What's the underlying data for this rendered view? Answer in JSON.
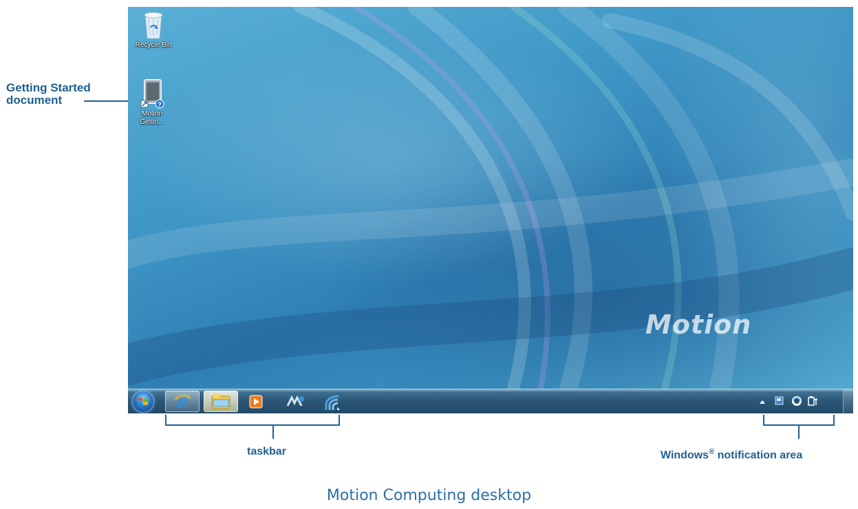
{
  "desktop": {
    "icons": [
      {
        "label": "Recycle Bin",
        "icon": "recycle-bin-icon"
      },
      {
        "label_line1": "Motion",
        "label_line2": "Gettin...",
        "icon": "getting-started-document-icon"
      }
    ],
    "brand": "Motion",
    "background_color": "#3f97c6"
  },
  "taskbar": {
    "items": [
      {
        "icon": "start-orb-icon"
      },
      {
        "icon": "internet-explorer-icon"
      },
      {
        "icon": "windows-explorer-icon"
      },
      {
        "icon": "media-player-icon"
      },
      {
        "icon": "motion-dashboard-icon"
      },
      {
        "icon": "wireless-icon"
      }
    ],
    "tray_icons": [
      "show-hidden-icons-arrow",
      "action-center-icon",
      "network-icon",
      "power-icon"
    ]
  },
  "callouts": {
    "getting_started_line1": "Getting Started",
    "getting_started_line2": "document",
    "taskbar": "taskbar",
    "notification_area": "Windows",
    "notification_area_mark": "®",
    "notification_area_rest": " notification area"
  },
  "caption": "Motion Computing desktop",
  "colors": {
    "callout": "#1f5f93",
    "caption": "#2d6ea6"
  }
}
